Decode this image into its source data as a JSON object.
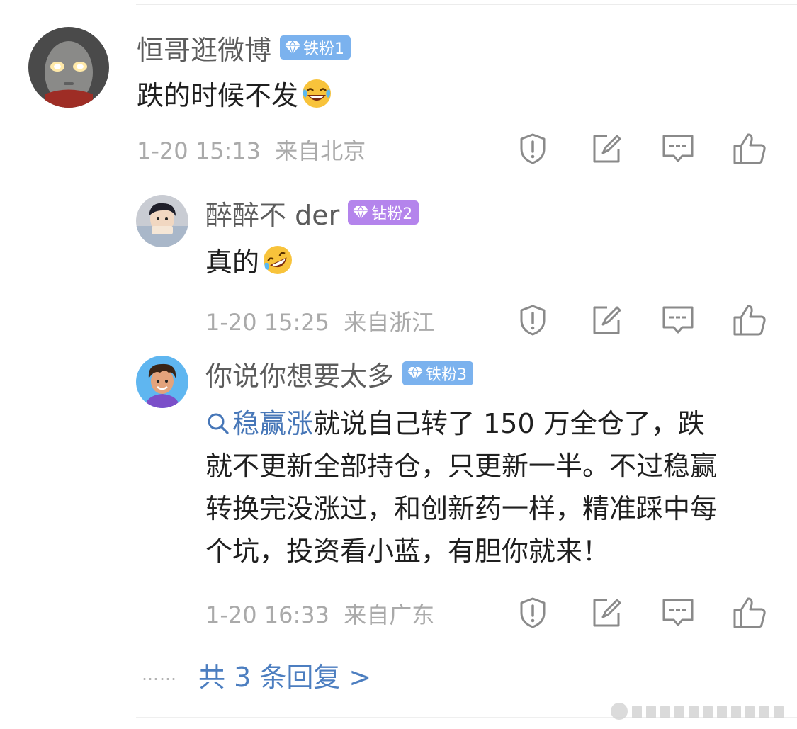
{
  "comment": {
    "user": "恒哥逛微博",
    "badge": "铁粉1",
    "text": "跌的时候不发",
    "emoji": "laughing-tears-emoji",
    "time": "1-20 15:13",
    "location": "来自北京"
  },
  "replies": [
    {
      "user": "醉醉不 der",
      "badge": "钻粉2",
      "text": "真的",
      "emoji": "rolling-laugh-emoji",
      "time": "1-20 15:25",
      "location": "来自浙江"
    },
    {
      "user": "你说你想要太多",
      "badge": "铁粉3",
      "topic": "稳赢涨",
      "lines": [
        "就说自己转了 150 万全仓了，跌",
        "就不更新全部持仓，只更新一半。不过稳赢",
        "转换完没涨过，和创新药一样，精准踩中每",
        "个坑，投资看小蓝，有胆你就来！"
      ],
      "time": "1-20 16:33",
      "location": "来自广东"
    }
  ],
  "actions": [
    "report-icon",
    "repost-icon",
    "comment-icon",
    "like-icon"
  ],
  "more_dots": "……",
  "more_replies": "共 3 条回复 >",
  "colors": {
    "link": "#4777b8",
    "iron_badge": "#7bb2ee",
    "drill_badge": "#b484ec",
    "meta": "#aaaaaa"
  }
}
